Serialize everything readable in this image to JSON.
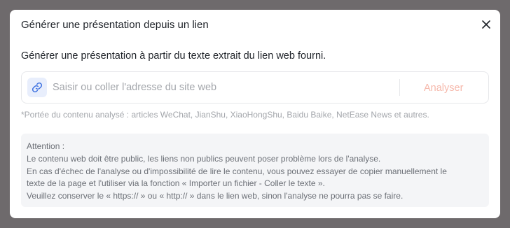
{
  "dialog": {
    "title": "Générer une présentation depuis un lien",
    "close_icon": "close-icon",
    "description": "Générer une présentation à partir du texte extrait du lien web fourni.",
    "url_input": {
      "icon": "link-icon",
      "placeholder": "Saisir ou coller l'adresse du site web",
      "value": ""
    },
    "analyse_label": "Analyser",
    "supported_note": "*Portée du contenu analysé : articles WeChat, JianShu, XiaoHongShu, Baidu Baike, NetEase News et autres.",
    "attention": {
      "heading": "Attention :",
      "lines": [
        "Le contenu web doit être public, les liens non publics peuvent poser problème lors de l'analyse.",
        "En cas d'échec de l'analyse ou d'impossibilité de lire le contenu, vous pouvez essayer de copier manuellement le",
        "texte de la page et l'utiliser via la fonction « Importer un fichier - Coller le texte ».",
        "Veuillez conserver le « https:// » ou « http:// » dans le lien web, sinon l'analyse ne pourra pas se faire."
      ]
    }
  },
  "colors": {
    "accent": "#3b6fe0",
    "analyse_disabled": "#f6b8ab",
    "overlay": "#6e6a6c"
  }
}
